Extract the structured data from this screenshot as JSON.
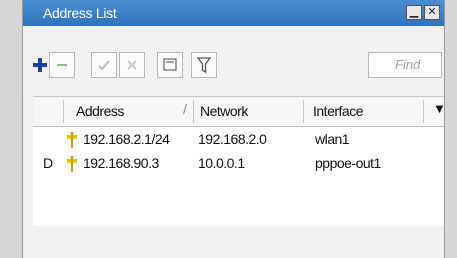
{
  "window": {
    "title": "Address List"
  },
  "toolbar": {
    "find_placeholder": "Find"
  },
  "table": {
    "headers": {
      "address": "Address",
      "network": "Network",
      "interface": "Interface"
    },
    "rows": [
      {
        "flag": "",
        "address": "192.168.2.1/24",
        "network": "192.168.2.0",
        "interface": "wlan1"
      },
      {
        "flag": "D",
        "address": "192.168.90.3",
        "network": "10.0.0.1",
        "interface": "pppoe-out1"
      }
    ]
  }
}
